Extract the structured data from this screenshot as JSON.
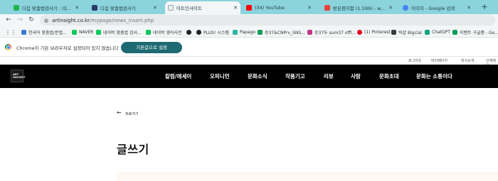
{
  "browser": {
    "tabs": [
      {
        "title": "다음 맞춤법검사기 : 네이버 검",
        "favicon_color": "#21b34a"
      },
      {
        "title": "다음 맞춤법검사기",
        "favicon_color": "#2b3a67"
      },
      {
        "title": "아트인사이트",
        "favicon_color": "#e9eef0"
      },
      {
        "title": "(34) YouTube",
        "favicon_color": "#ff0000"
      },
      {
        "title": "받은편지함 (1,599) - wonsam",
        "favicon_color": "#ea4335"
      },
      {
        "title": "이미지 - Google 검색",
        "favicon_color": "#4285f4"
      }
    ],
    "close_glyph": "✕",
    "new_tab_glyph": "+",
    "nav": {
      "back": "←",
      "forward": "→",
      "reload": "↻"
    },
    "url": {
      "host": "artinsight.co.kr",
      "path": "/mypage/news_insert.php"
    },
    "bookmarks": [
      {
        "label": "한국어 맞춤법/문법...",
        "icon_color": "#3a7bd5"
      },
      {
        "label": "NAVER",
        "icon_color": "#03c75a"
      },
      {
        "label": "네이버 맞춤법 검사...",
        "icon_color": "#03c75a"
      },
      {
        "label": "네이버 영어사전",
        "icon_color": "#03c75a"
      },
      {
        "label": "",
        "icon_color": "#222222"
      },
      {
        "label": "PLUS! 시스템",
        "icon_color": "#222222"
      },
      {
        "label": "Papago",
        "icon_color": "#2bb5a2"
      },
      {
        "label": "승37&CNPrv_SNS...",
        "icon_color": "#0f9d58"
      },
      {
        "label": "승37두 sum37 offi...",
        "icon_color": "#c13584"
      },
      {
        "label": "(1) Pinterest",
        "icon_color": "#e60023"
      },
      {
        "label": "빅샵 Bigclal",
        "icon_color": "#3b3b3b"
      },
      {
        "label": "ChatGPT",
        "icon_color": "#10a37f"
      },
      {
        "label": "이벤트 구글폼 - Go...",
        "icon_color": "#0f9d58"
      }
    ]
  },
  "infobar": {
    "message": "Chrome이 기본 브라우저로 설정되어 있지 않습니다",
    "button": "기본값으로 설정"
  },
  "site": {
    "utility_links": [
      "로그아웃",
      "마이페이지",
      "회사소개",
      "인재채용"
    ],
    "logo_text": "ART INSIGHT",
    "gnb": [
      "칼럼/에세이",
      "오피니언",
      "문화소식",
      "작품기고",
      "리뷰",
      "사람",
      "문화초대",
      "문화는 소통이다"
    ]
  },
  "content": {
    "back_arrow": "←",
    "back_label": "뒤로가기",
    "page_title": "글쓰기"
  }
}
